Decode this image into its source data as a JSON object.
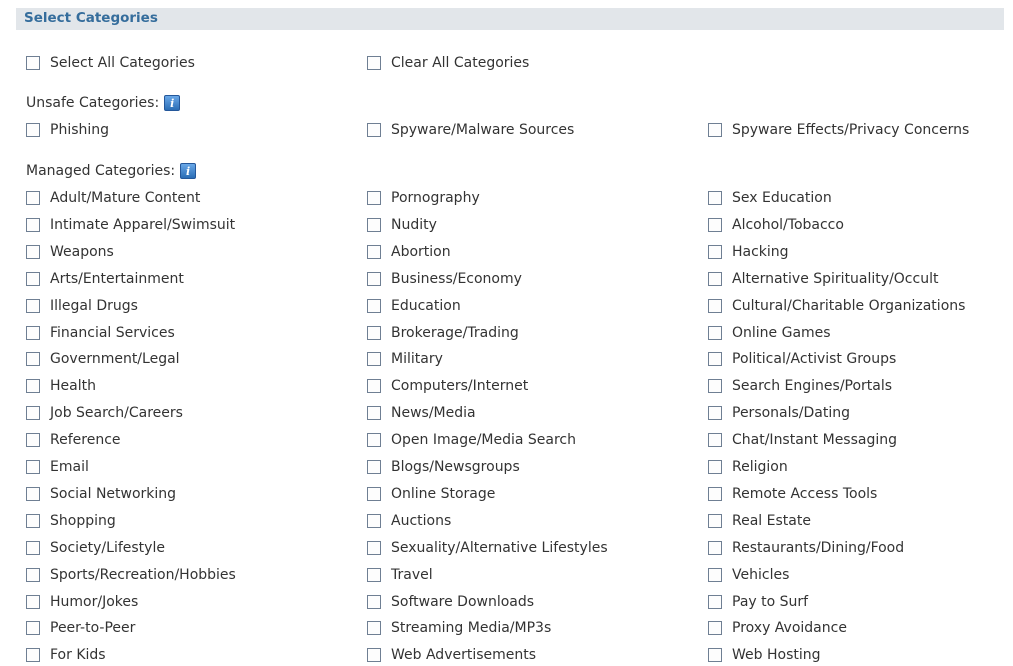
{
  "header": {
    "title": "Select Categories"
  },
  "actions": {
    "select_all": "Select All Categories",
    "clear_all": "Clear All Categories"
  },
  "unsafe": {
    "label": "Unsafe Categories:",
    "info_icon": "i",
    "items": [
      "Phishing",
      "Spyware/Malware Sources",
      "Spyware Effects/Privacy Concerns"
    ]
  },
  "managed": {
    "label": "Managed Categories:",
    "info_icon": "i",
    "items": [
      "Adult/Mature Content",
      "Pornography",
      "Sex Education",
      "Intimate Apparel/Swimsuit",
      "Nudity",
      "Alcohol/Tobacco",
      "Weapons",
      "Abortion",
      "Hacking",
      "Arts/Entertainment",
      "Business/Economy",
      "Alternative Spirituality/Occult",
      "Illegal Drugs",
      "Education",
      "Cultural/Charitable Organizations",
      "Financial Services",
      "Brokerage/Trading",
      "Online Games",
      "Government/Legal",
      "Military",
      "Political/Activist Groups",
      "Health",
      "Computers/Internet",
      "Search Engines/Portals",
      "Job Search/Careers",
      "News/Media",
      "Personals/Dating",
      "Reference",
      "Open Image/Media Search",
      "Chat/Instant Messaging",
      "Email",
      "Blogs/Newsgroups",
      "Religion",
      "Social Networking",
      "Online Storage",
      "Remote Access Tools",
      "Shopping",
      "Auctions",
      "Real Estate",
      "Society/Lifestyle",
      "Sexuality/Alternative Lifestyles",
      "Restaurants/Dining/Food",
      "Sports/Recreation/Hobbies",
      "Travel",
      "Vehicles",
      "Humor/Jokes",
      "Software Downloads",
      "Pay to Surf",
      "Peer-to-Peer",
      "Streaming Media/MP3s",
      "Proxy Avoidance",
      "For Kids",
      "Web Advertisements",
      "Web Hosting"
    ]
  }
}
